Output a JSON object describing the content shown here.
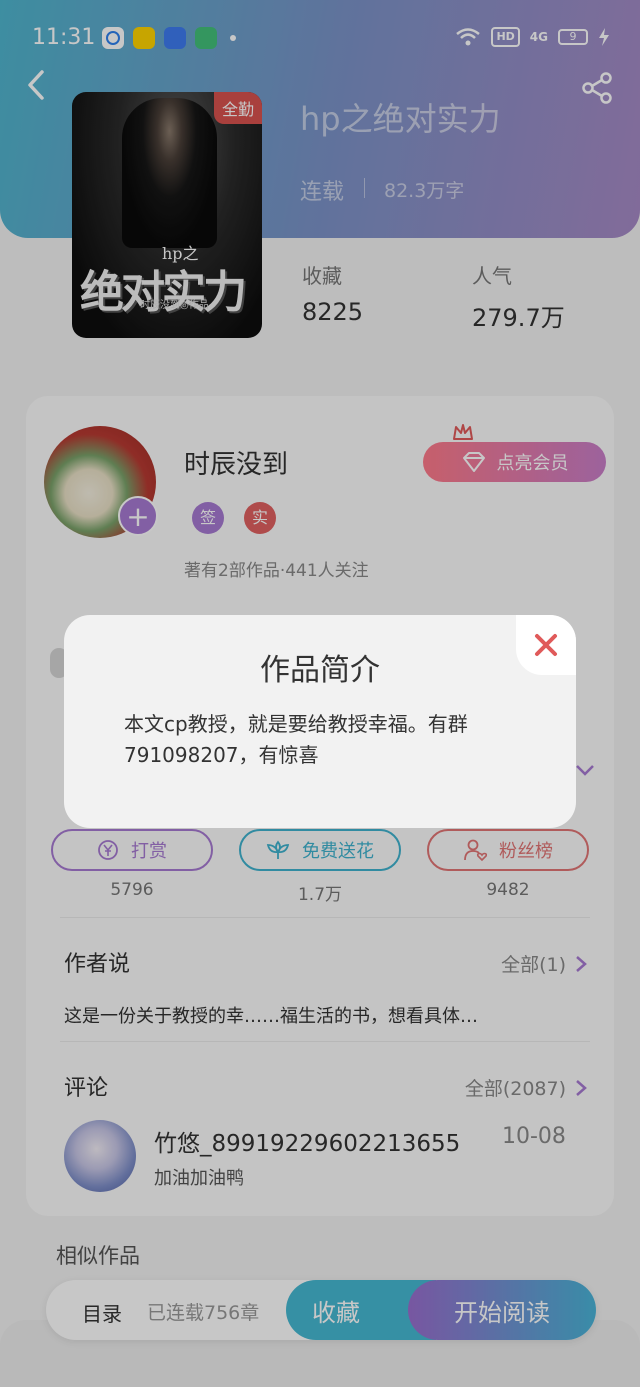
{
  "status_bar": {
    "time": "11:31",
    "net": "4G",
    "hd": "HD",
    "battery": "9"
  },
  "book": {
    "title": "hp之绝对实力",
    "status": "连载",
    "words": "82.3万字",
    "cover_tag": "全勤",
    "cover_sub": "hp之",
    "cover_big": "绝对实力",
    "cover_author": "时辰没到◎作品"
  },
  "stats": [
    {
      "label": "收藏",
      "value": "8225"
    },
    {
      "label": "人气",
      "value": "279.7万"
    }
  ],
  "author": {
    "name": "时辰没到",
    "badges": [
      "签",
      "实"
    ],
    "meta": "著有2部作品·441人关注",
    "vip_label": "点亮会员"
  },
  "actions": [
    {
      "label": "打赏",
      "count": "5796",
      "color": "#a77ad2"
    },
    {
      "label": "免费送花",
      "count": "1.7万",
      "color": "#3fb3cf"
    },
    {
      "label": "粉丝榜",
      "count": "9482",
      "color": "#e27575"
    }
  ],
  "author_says": {
    "title": "作者说",
    "more": "全部(1)",
    "text": "这是一份关于教授的幸……福生活的书，想看具体…"
  },
  "comments": {
    "title": "评论",
    "more": "全部(2087)",
    "items": [
      {
        "user": "竹悠_89919229602213655",
        "date": "10-08",
        "text": "加油加油鸭"
      }
    ]
  },
  "similar_title": "相似作品",
  "bottom_bar": {
    "toc": "目录",
    "chapters": "已连载756章",
    "favorite": "收藏",
    "read": "开始阅读"
  },
  "modal": {
    "title": "作品简介",
    "body": "本文cp教授，就是要给教授幸福。有群791098207，有惊喜"
  },
  "colors": {
    "accent_purple": "#a77ad2",
    "accent_cyan": "#46b9d3",
    "accent_red": "#e05a5a"
  }
}
